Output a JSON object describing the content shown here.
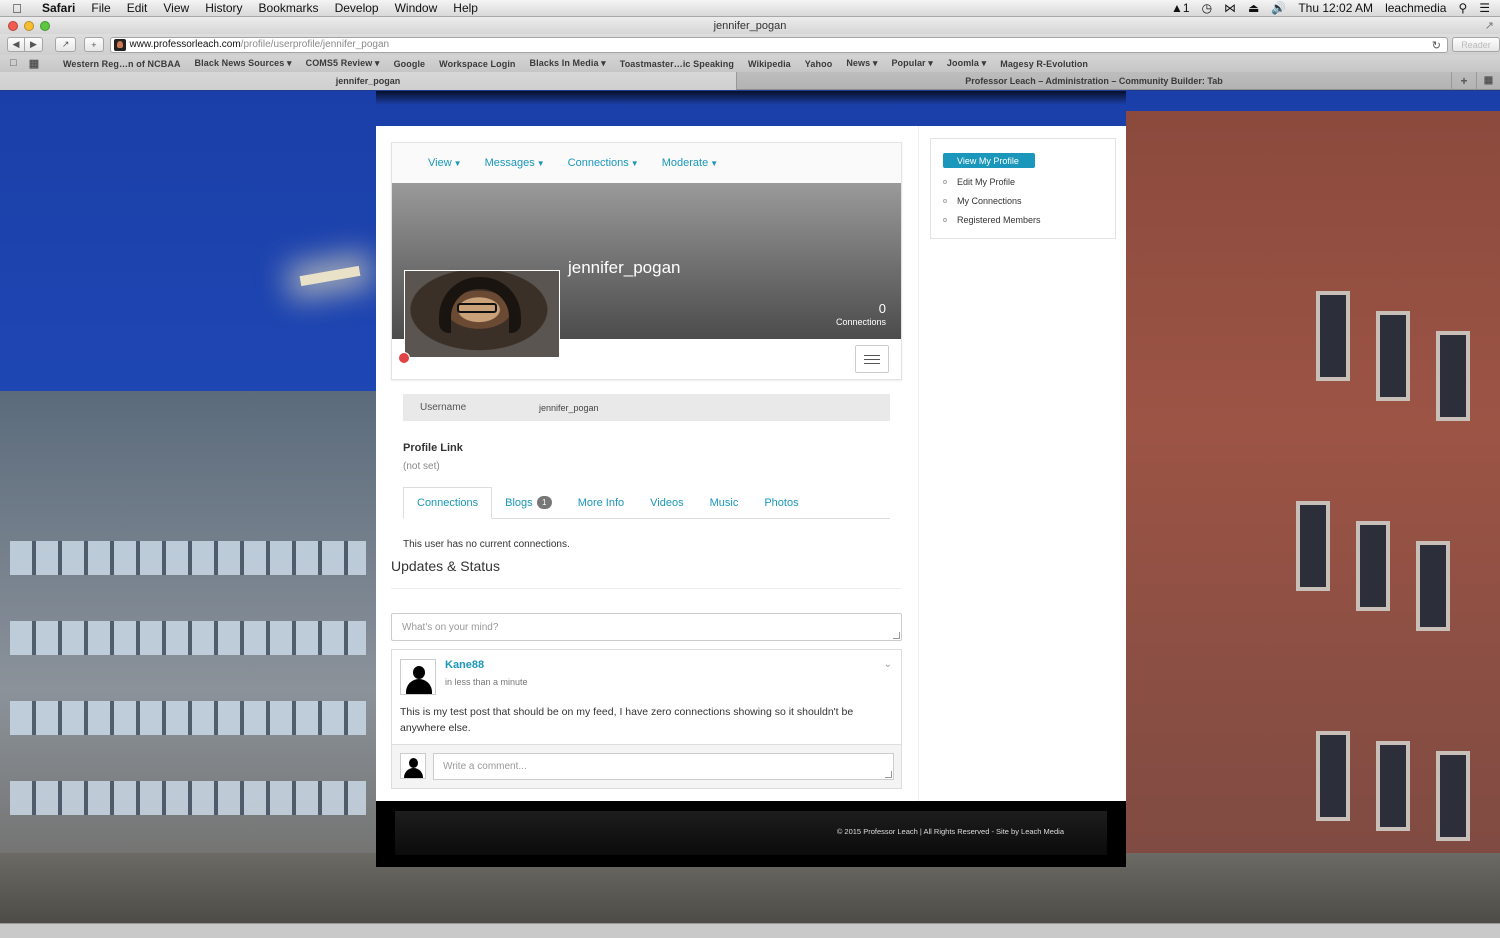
{
  "menubar": {
    "app": "Safari",
    "items": [
      "File",
      "Edit",
      "View",
      "History",
      "Bookmarks",
      "Develop",
      "Window",
      "Help"
    ],
    "battery": "1",
    "clock": "Thu 12:02 AM",
    "user": "leachmedia"
  },
  "window": {
    "title": "jennifer_pogan"
  },
  "toolbar": {
    "url_host": "www.professorleach.com",
    "url_path": "/profile/userprofile/jennifer_pogan",
    "reader": "Reader"
  },
  "bookmarks": [
    "Western Reg…n of NCBAA",
    "Black News Sources ▾",
    "COMS5 Review ▾",
    "Google",
    "Workspace Login",
    "Blacks In Media ▾",
    "Toastmaster…ic Speaking",
    "Wikipedia",
    "Yahoo",
    "News ▾",
    "Popular ▾",
    "Joomla ▾",
    "Magesy R-Evolution"
  ],
  "tabs": {
    "active": "jennifer_pogan",
    "inactive": "Professor Leach – Administration – Community Builder: Tab"
  },
  "profile": {
    "nav": [
      "View",
      "Messages",
      "Connections",
      "Moderate"
    ],
    "name": "jennifer_pogan",
    "connections_count": "0",
    "connections_label": "Connections",
    "username_label": "Username",
    "username_value": "jennifer_pogan",
    "profile_link_title": "Profile Link",
    "profile_link_value": "(not set)",
    "tabs": {
      "connections": "Connections",
      "blogs": "Blogs",
      "blogs_badge": "1",
      "more_info": "More Info",
      "videos": "Videos",
      "music": "Music",
      "photos": "Photos"
    },
    "no_connections": "This user has no current connections."
  },
  "updates": {
    "title": "Updates & Status",
    "status_placeholder": "What's on your mind?",
    "post": {
      "author": "Kane88",
      "time": "in less than a minute",
      "body": "This is my test post that should be on my feed, I have zero connections showing so it shouldn't be anywhere else."
    },
    "comment_placeholder": "Write a comment..."
  },
  "sidebar": {
    "items": [
      "View My Profile",
      "Edit My Profile",
      "My Connections",
      "Registered Members"
    ]
  },
  "footer": {
    "copyright": "© 2015 Professor Leach | All Rights Reserved - Site by Leach Media"
  },
  "colors": {
    "accent": "#1a97ba",
    "status_offline": "#e04444"
  }
}
